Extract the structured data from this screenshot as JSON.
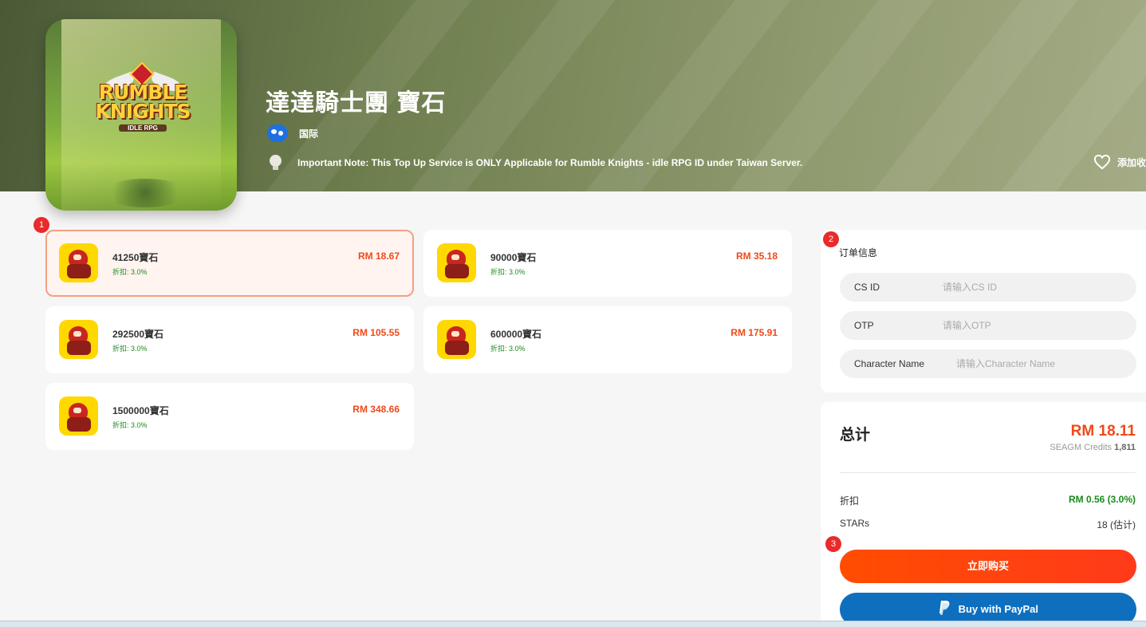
{
  "header": {
    "title": "達達騎士團 寶石",
    "region": "国际",
    "note": "Important Note: This Top Up Service is ONLY Applicable for Rumble Knights - idle RPG ID under Taiwan Server.",
    "favorite_label": "添加收",
    "game_logo_top": "RUMBLE KNIGHTS",
    "game_logo_sub": "IDLE RPG"
  },
  "badges": [
    "1",
    "2",
    "3"
  ],
  "products": [
    {
      "name": "41250寶石",
      "discount": "折扣: 3.0%",
      "price": "RM 18.67",
      "selected": true
    },
    {
      "name": "90000寶石",
      "discount": "折扣: 3.0%",
      "price": "RM 35.18",
      "selected": false
    },
    {
      "name": "292500寶石",
      "discount": "折扣: 3.0%",
      "price": "RM 105.55",
      "selected": false
    },
    {
      "name": "600000寶石",
      "discount": "折扣: 3.0%",
      "price": "RM 175.91",
      "selected": false
    },
    {
      "name": "1500000寶石",
      "discount": "折扣: 3.0%",
      "price": "RM 348.66",
      "selected": false
    }
  ],
  "order": {
    "title": "订单信息",
    "fields": [
      {
        "label": "CS ID",
        "placeholder": "请输入CS ID",
        "value": ""
      },
      {
        "label": "OTP",
        "placeholder": "请输入OTP",
        "value": ""
      },
      {
        "label": "Character Name",
        "placeholder": "请输入Character Name",
        "value": ""
      }
    ]
  },
  "total": {
    "label": "总计",
    "price": "RM 18.11",
    "credits_label": "SEAGM Credits",
    "credits_value": "1,811",
    "discount_label": "折扣",
    "discount_value": "RM 0.56 (3.0%)",
    "stars_label": "STARs",
    "stars_value": "18 (估计)",
    "buy_label": "立即购买",
    "paypal_label": "Buy with PayPal"
  },
  "colors": {
    "accent": "#ee4a1a",
    "discount_green": "#1b8a1b",
    "paypal_blue": "#0e6fbf",
    "buy_orange": "#ff4d00"
  }
}
